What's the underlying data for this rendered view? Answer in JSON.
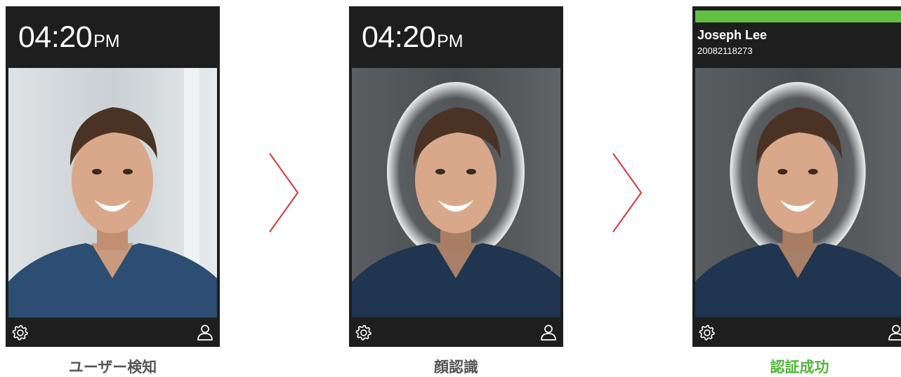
{
  "steps": [
    {
      "clock_time": "04:20",
      "clock_ampm": "PM",
      "caption": "ユーザー検知"
    },
    {
      "clock_time": "04:20",
      "clock_ampm": "PM",
      "caption": "顔認識"
    },
    {
      "user_name": "Joseph Lee",
      "user_id": "20082118273",
      "caption": "認証成功"
    }
  ],
  "icons": {
    "settings": "gear-icon",
    "user": "user-icon",
    "arrow": "chevron-right-icon"
  },
  "colors": {
    "device_frame": "#1e1e1e",
    "arrow": "#d9343b",
    "success": "#62c141",
    "caption_default": "#555555",
    "caption_success": "#52b43a"
  }
}
